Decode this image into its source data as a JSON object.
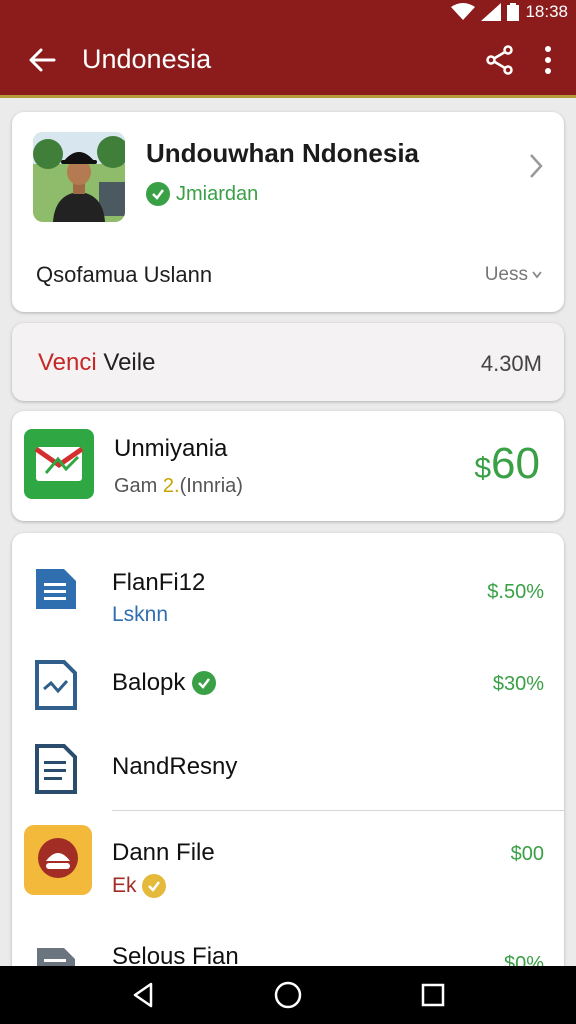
{
  "status_bar": {
    "time": "18:38"
  },
  "app_bar": {
    "title": "Undonesia"
  },
  "profile": {
    "name": "Undouwhan Ndonesia",
    "status": "Jmiardan",
    "subtitle": "Qsofamua Uslann",
    "action_label": "Uess"
  },
  "summary": {
    "label_red": "Venci",
    "label_dark": "Veile",
    "value": "4.30M"
  },
  "featured": {
    "title": "Unmiyania",
    "sub_prefix": "Gam",
    "sub_accent": "2.",
    "sub_suffix": "(Innria)",
    "price_symbol": "$",
    "price_value": "60"
  },
  "list": {
    "items": [
      {
        "title": "FlanFi12",
        "subtitle": "Lsknn",
        "value": "$.50%",
        "icon": "document-icon"
      },
      {
        "title": "Balopk",
        "value": "$30%",
        "icon": "chart-document-icon"
      },
      {
        "title": "NandResny",
        "icon": "list-document-icon"
      },
      {
        "title": "Dann File",
        "subtitle": "Ek",
        "value": "$00",
        "icon": "app-icon"
      },
      {
        "title": "Selous Fian",
        "value": "$0%",
        "icon": "file-icon"
      }
    ]
  },
  "colors": {
    "brand": "#8c1c1c",
    "accent_green": "#3aa046",
    "accent_yellow": "#c8a400"
  }
}
